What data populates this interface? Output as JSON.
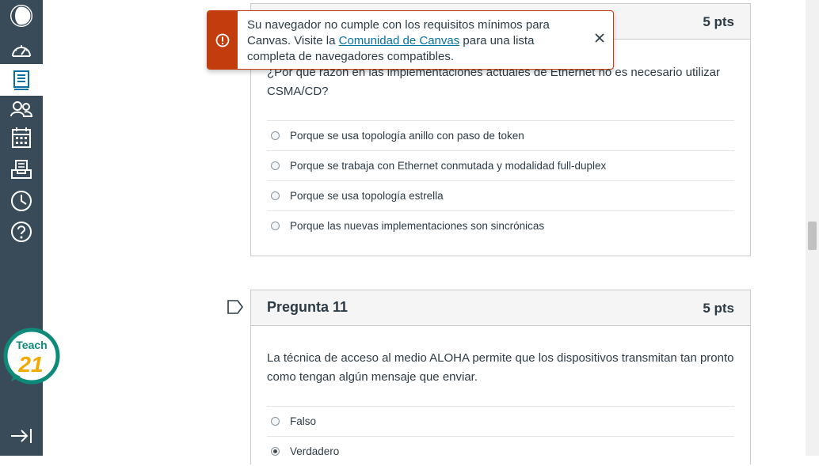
{
  "nav": {
    "items": [
      {
        "icon": "profile-icon"
      },
      {
        "icon": "dashboard-icon"
      },
      {
        "icon": "courses-icon",
        "active": true
      },
      {
        "icon": "groups-icon"
      },
      {
        "icon": "calendar-icon"
      },
      {
        "icon": "inbox-icon"
      },
      {
        "icon": "history-icon"
      },
      {
        "icon": "help-icon"
      }
    ],
    "teach_badge": {
      "line1": "Teach",
      "line2": "21"
    },
    "collapse_icon": "collapse-nav-icon"
  },
  "alert": {
    "text_before": "Su navegador no cumple con los requisitos mínimos para Canvas. Visite la ",
    "link_text": "Comunidad de Canvas",
    "text_after": " para una lista completa de navegadores compatibles.",
    "icon": "warning-icon",
    "close_icon": "close-icon",
    "color": "#c23c0d"
  },
  "question10": {
    "points": "5 pts",
    "text": "¿Por qué razón en las implementaciones actuales de Ethernet no es necesario utilizar CSMA/CD?",
    "answers": [
      {
        "label": "Porque se usa topología anillo con paso de token",
        "checked": false
      },
      {
        "label": "Porque se trabaja con Ethernet conmutada y modalidad full-duplex",
        "checked": false
      },
      {
        "label": "Porque se usa topología estrella",
        "checked": false
      },
      {
        "label": "Porque las nuevas implementaciones son sincrónicas",
        "checked": false
      }
    ]
  },
  "question11": {
    "title": "Pregunta 11",
    "points": "5 pts",
    "text": "La técnica de acceso al medio ALOHA permite que los dispositivos transmitan tan pronto como tengan algún mensaje que enviar.",
    "answers": [
      {
        "label": "Falso",
        "checked": false
      },
      {
        "label": "Verdadero",
        "checked": true
      }
    ]
  }
}
